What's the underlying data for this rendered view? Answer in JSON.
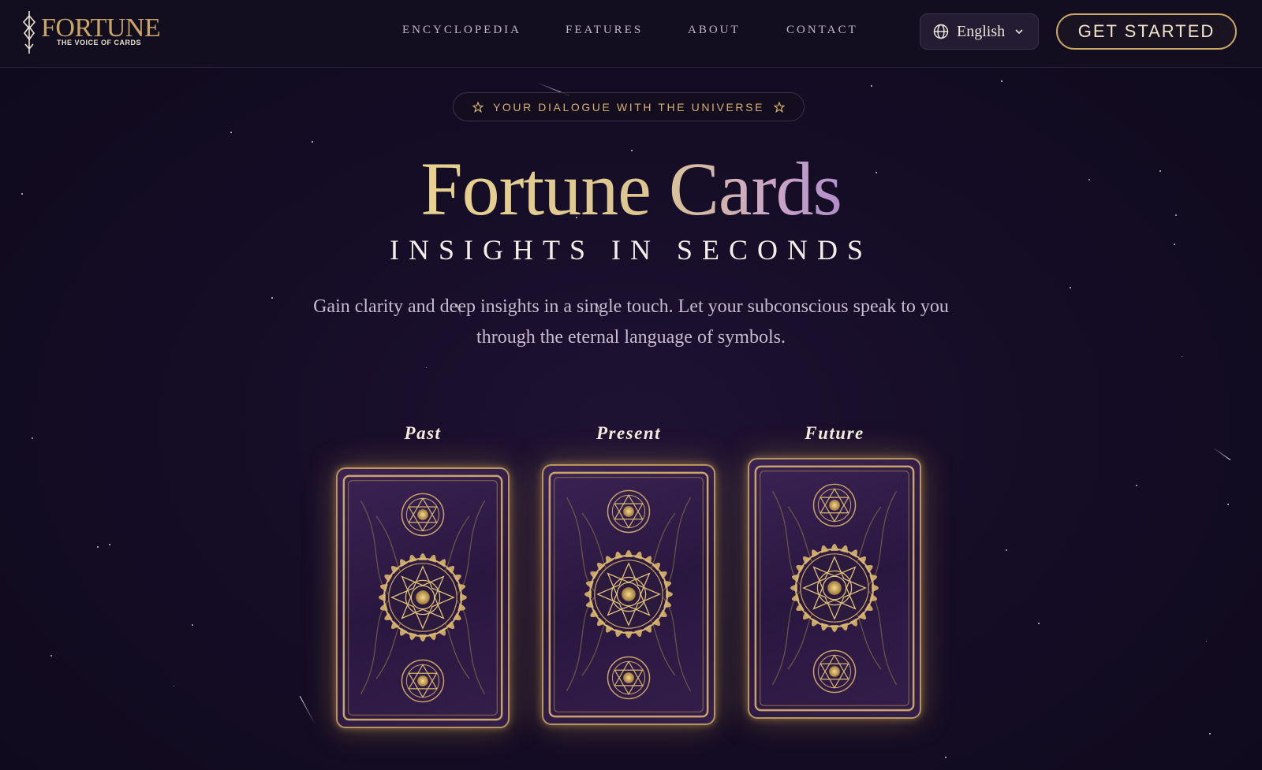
{
  "brand": {
    "name": "FORTUNE",
    "tagline": "THE VOICE OF CARDS"
  },
  "nav": {
    "items": [
      {
        "label": "ENCYCLOPEDIA"
      },
      {
        "label": "FEATURES"
      },
      {
        "label": "ABOUT"
      },
      {
        "label": "CONTACT"
      }
    ]
  },
  "language": {
    "selected": "English",
    "icon": "globe-icon"
  },
  "cta": {
    "label": "GET STARTED"
  },
  "hero": {
    "eyebrow": "YOUR DIALOGUE WITH THE UNIVERSE",
    "title": "Fortune Cards",
    "subtitle": "INSIGHTS IN SECONDS",
    "description": "Gain clarity and deep insights in a single touch. Let your subconscious speak to you through the eternal language of symbols."
  },
  "spread": {
    "cards": [
      {
        "label": "Past"
      },
      {
        "label": "Present"
      },
      {
        "label": "Future"
      }
    ]
  },
  "colors": {
    "gold": "#c9a566",
    "background": "#150d26",
    "card_back": "#2a1740"
  }
}
